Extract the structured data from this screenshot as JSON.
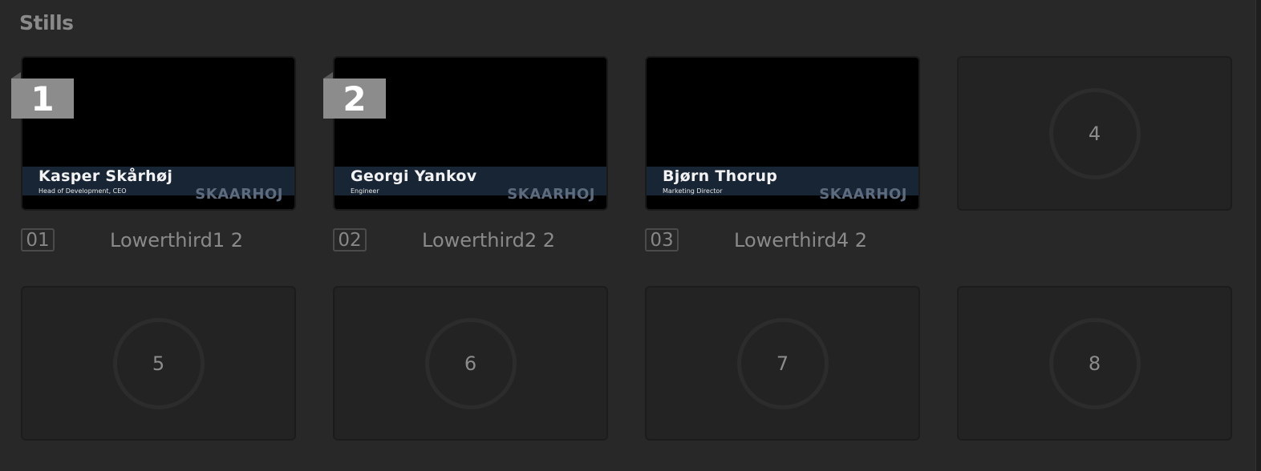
{
  "panel": {
    "title": "Stills"
  },
  "slots": [
    {
      "badge": "1",
      "name": "Kasper Skårhøj",
      "role": "Head of Development, CEO",
      "brand": "SKAARHOJ",
      "index_label": "01",
      "file_name": "Lowerthird1 2"
    },
    {
      "badge": "2",
      "name": "Georgi Yankov",
      "role": "Engineer",
      "brand": "SKAARHOJ",
      "index_label": "02",
      "file_name": "Lowerthird2 2"
    },
    {
      "name": "Bjørn Thorup",
      "role": "Marketing Director",
      "brand": "SKAARHOJ",
      "index_label": "03",
      "file_name": "Lowerthird4 2"
    },
    {
      "number": "4"
    },
    {
      "number": "5"
    },
    {
      "number": "6"
    },
    {
      "number": "7"
    },
    {
      "number": "8"
    }
  ]
}
